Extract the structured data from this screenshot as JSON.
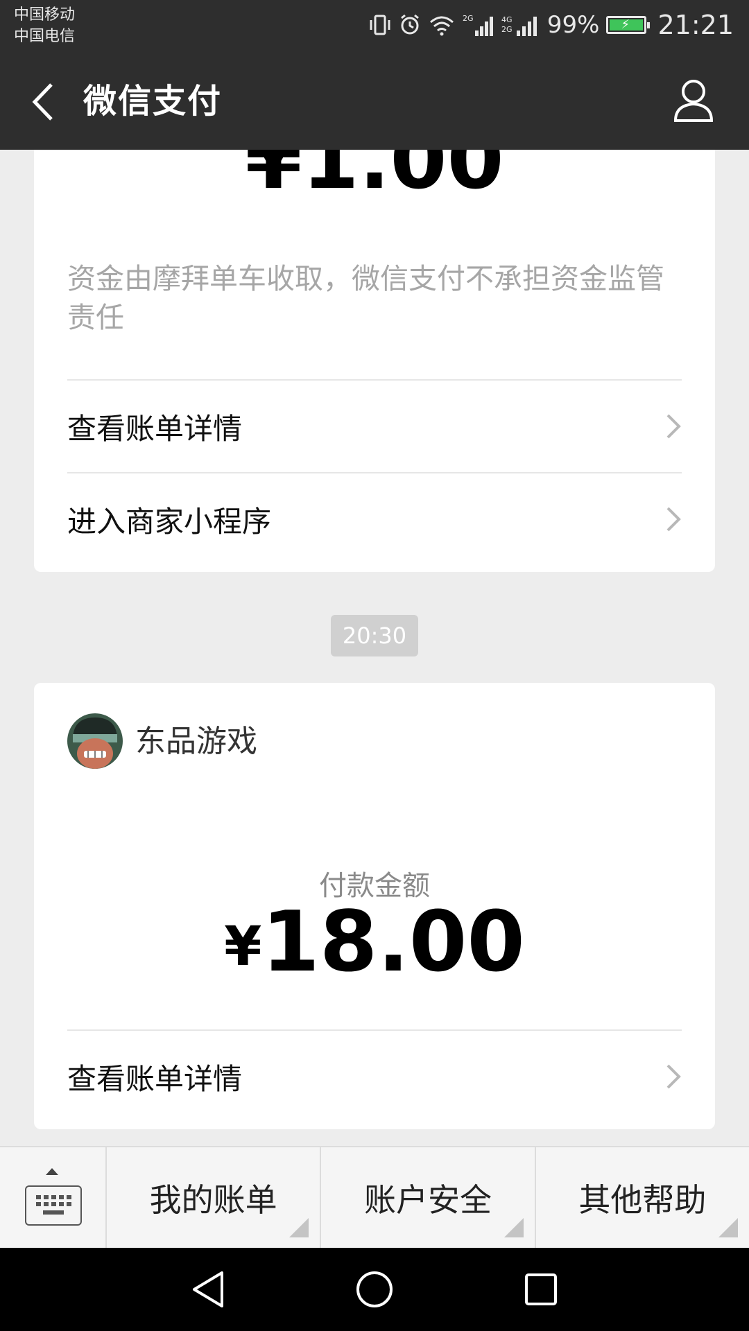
{
  "status_bar": {
    "carrier1": "中国移动",
    "carrier2": "中国电信",
    "battery_percent": "99%",
    "battery_level": 0.99,
    "time": "21:21",
    "icons": [
      "vibrate-icon",
      "alarm-icon",
      "wifi-icon",
      "signal-2g-icon",
      "signal-4g-icon",
      "battery-icon"
    ]
  },
  "nav": {
    "title": "微信支付",
    "back_icon": "chevron-left-icon",
    "profile_icon": "user-icon"
  },
  "card1": {
    "amount_partial": "¥1.00",
    "notice": "资金由摩拜单车收取，微信支付不承担资金监管责任",
    "rows": [
      {
        "label": "查看账单详情"
      },
      {
        "label": "进入商家小程序"
      }
    ]
  },
  "timestamp": "20:30",
  "card2": {
    "merchant": "东品游戏",
    "pay_label": "付款金额",
    "currency": "¥",
    "amount": "18.00",
    "rows": [
      {
        "label": "查看账单详情"
      }
    ]
  },
  "menu": {
    "items": [
      {
        "label": "我的账单"
      },
      {
        "label": "账户安全"
      },
      {
        "label": "其他帮助"
      }
    ]
  },
  "colors": {
    "header_bg": "#2e2e2e",
    "page_bg": "#ededed",
    "card_bg": "#ffffff",
    "battery_green": "#3fc45a"
  }
}
